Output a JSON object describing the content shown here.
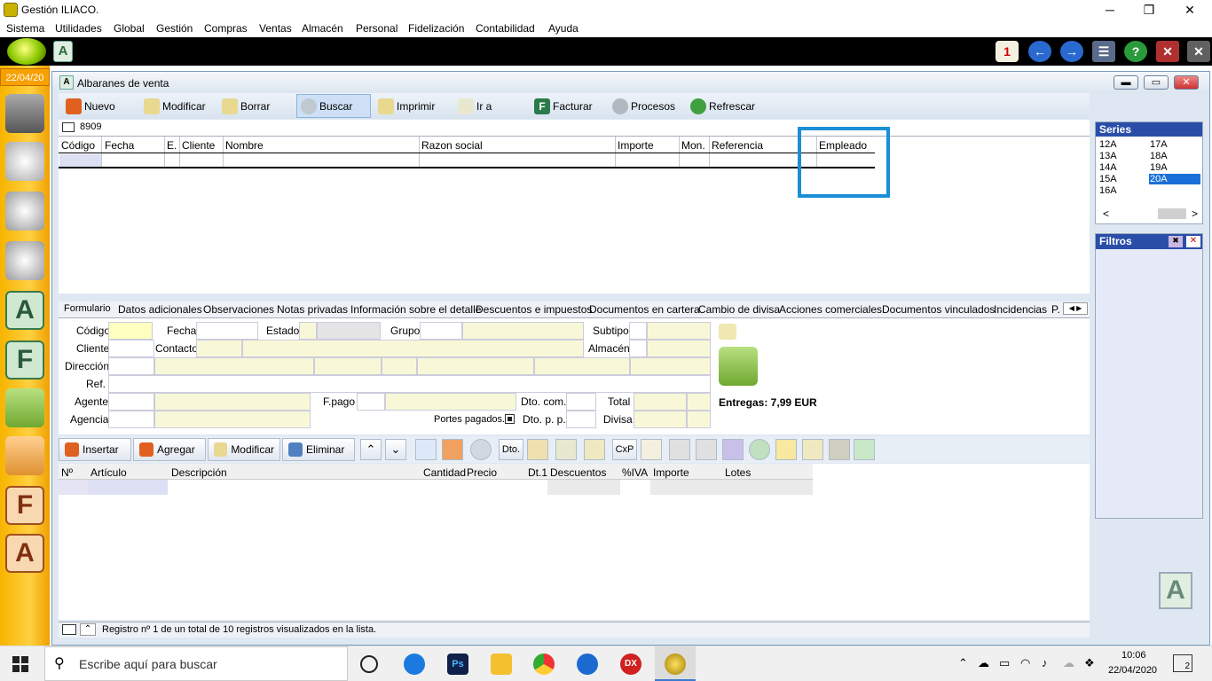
{
  "app": {
    "title": "Gestión ILIACO."
  },
  "menu": [
    "Sistema",
    "Utilidades",
    "Global",
    "Gestión",
    "Compras",
    "Ventas",
    "Almacén",
    "Personal",
    "Fidelización",
    "Contabilidad",
    "Ayuda"
  ],
  "sidebar": {
    "date": "22/04/20"
  },
  "window": {
    "title": "Albaranes de venta"
  },
  "toolbar": {
    "nuevo": "Nuevo",
    "modificar": "Modificar",
    "borrar": "Borrar",
    "buscar": "Buscar",
    "imprimir": "Imprimir",
    "ir_a": "Ir a",
    "facturar": "Facturar",
    "procesos": "Procesos",
    "refrescar": "Refrescar"
  },
  "search": {
    "value": "8909"
  },
  "grid": {
    "columns": [
      "Código",
      "Fecha",
      "E.",
      "Cliente",
      "Nombre",
      "Razon social",
      "Importe",
      "Mon.",
      "Referencia",
      "Empleado"
    ]
  },
  "series": {
    "title": "Series",
    "col1": [
      "12A",
      "13A",
      "14A",
      "15A",
      "16A"
    ],
    "col2": [
      "17A",
      "18A",
      "19A",
      "20A"
    ],
    "selected": "20A"
  },
  "filtros": {
    "title": "Filtros"
  },
  "tabs": [
    "Formulario",
    "Datos adicionales",
    "Observaciones",
    "Notas privadas",
    "Información sobre el detalle",
    "Descuentos e impuestos",
    "Documentos en cartera",
    "Cambio de divisa",
    "Acciones comerciales",
    "Documentos vinculados",
    "Incidencias",
    "P."
  ],
  "form": {
    "codigo": "Código",
    "fecha": "Fecha",
    "estado": "Estado",
    "grupo": "Grupo",
    "subtipo": "Subtipo",
    "cliente": "Cliente",
    "contacto": "Contacto",
    "almacen": "Almacén",
    "direccion": "Dirección",
    "ref": "Ref.",
    "agente": "Agente",
    "fpago": "F.pago",
    "dto_com": "Dto. com.",
    "total": "Total",
    "agencia": "Agencia",
    "portes": "Portes pagados.",
    "dto_pp": "Dto. p. p.",
    "divisa": "Divisa",
    "entregas": "Entregas: 7,99 EUR"
  },
  "detail_toolbar": {
    "insertar": "Insertar",
    "agregar": "Agregar",
    "modificar": "Modificar",
    "eliminar": "Eliminar",
    "dto": "Dto.",
    "cxp": "CxP"
  },
  "detail_grid": {
    "columns": [
      "Nº",
      "Artículo",
      "Descripción",
      "Cantidad",
      "Precio",
      "Dt.1",
      "Descuentos",
      "%IVA",
      "Importe",
      "Lotes"
    ]
  },
  "status": {
    "text": "Registro nº 1 de un total de 10 registros visualizados en la lista."
  },
  "taskbar": {
    "search_placeholder": "Escribe aquí para buscar",
    "time": "10:06",
    "date": "22/04/2020",
    "notifications": "2"
  }
}
